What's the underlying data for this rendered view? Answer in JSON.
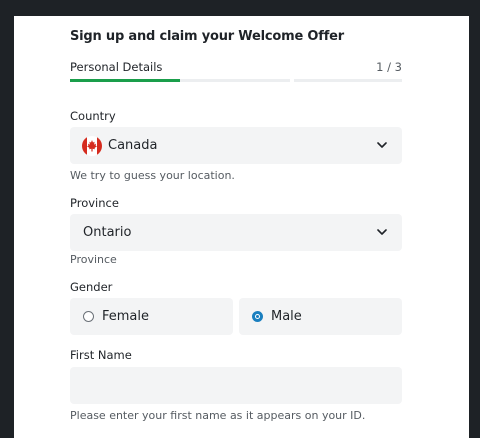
{
  "form": {
    "title": "Sign up and claim your Welcome Offer",
    "step_label": "Personal Details",
    "step_count": "1 / 3",
    "progress_fraction": 0.5
  },
  "country": {
    "label": "Country",
    "value": "Canada",
    "flag_icon": "canada-flag-icon",
    "hint": "We try to guess your location."
  },
  "province": {
    "label": "Province",
    "value": "Ontario",
    "hint": "Province"
  },
  "gender": {
    "label": "Gender",
    "options": [
      {
        "label": "Female",
        "selected": false
      },
      {
        "label": "Male",
        "selected": true
      }
    ]
  },
  "first_name": {
    "label": "First Name",
    "value": "",
    "hint": "Please enter your first name as it appears on your ID."
  },
  "colors": {
    "progress": "#1a9e4b",
    "radio_selected": "#1a7fbf",
    "field_bg": "#f3f4f5",
    "backdrop": "#1e2226"
  }
}
